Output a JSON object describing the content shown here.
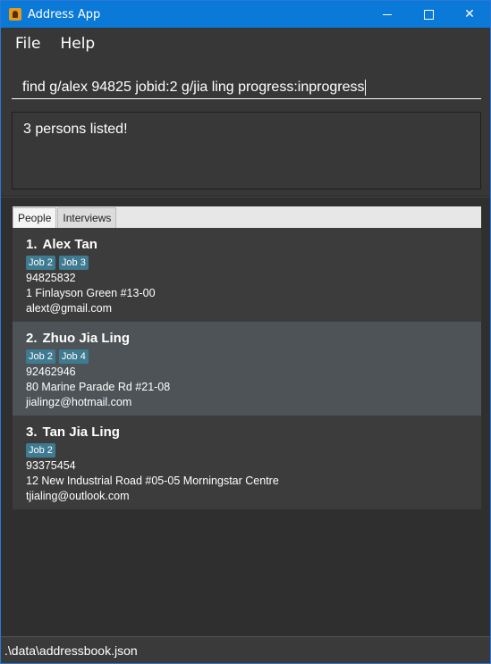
{
  "window": {
    "title": "Address App",
    "icon": "address-book-icon"
  },
  "menu": [
    {
      "label": "File"
    },
    {
      "label": "Help"
    }
  ],
  "command": {
    "value": "find g/alex 94825 jobid:2 g/jia ling progress:inprogress"
  },
  "result": {
    "text": "3 persons listed!"
  },
  "tabs": [
    {
      "label": "People",
      "active": true
    },
    {
      "label": "Interviews",
      "active": false
    }
  ],
  "persons": [
    {
      "index": "1.",
      "name": "Alex Tan",
      "tags": [
        "Job 2",
        "Job 3"
      ],
      "phone": "94825832",
      "address": "1 Finlayson Green #13-00",
      "email": "alext@gmail.com"
    },
    {
      "index": "2.",
      "name": "Zhuo Jia Ling",
      "tags": [
        "Job 2",
        "Job 4"
      ],
      "phone": "92462946",
      "address": "80 Marine Parade Rd #21-08",
      "email": "jialingz@hotmail.com"
    },
    {
      "index": "3.",
      "name": "Tan Jia Ling",
      "tags": [
        "Job 2"
      ],
      "phone": "93375454",
      "address": "12 New Industrial Road #05-05 Morningstar Centre",
      "email": "tjialing@outlook.com"
    }
  ],
  "status": {
    "path": ".\\data\\addressbook.json"
  },
  "colors": {
    "titlebar": "#0a79d8",
    "tag": "#3e7b91",
    "background": "#2b2b2b"
  }
}
